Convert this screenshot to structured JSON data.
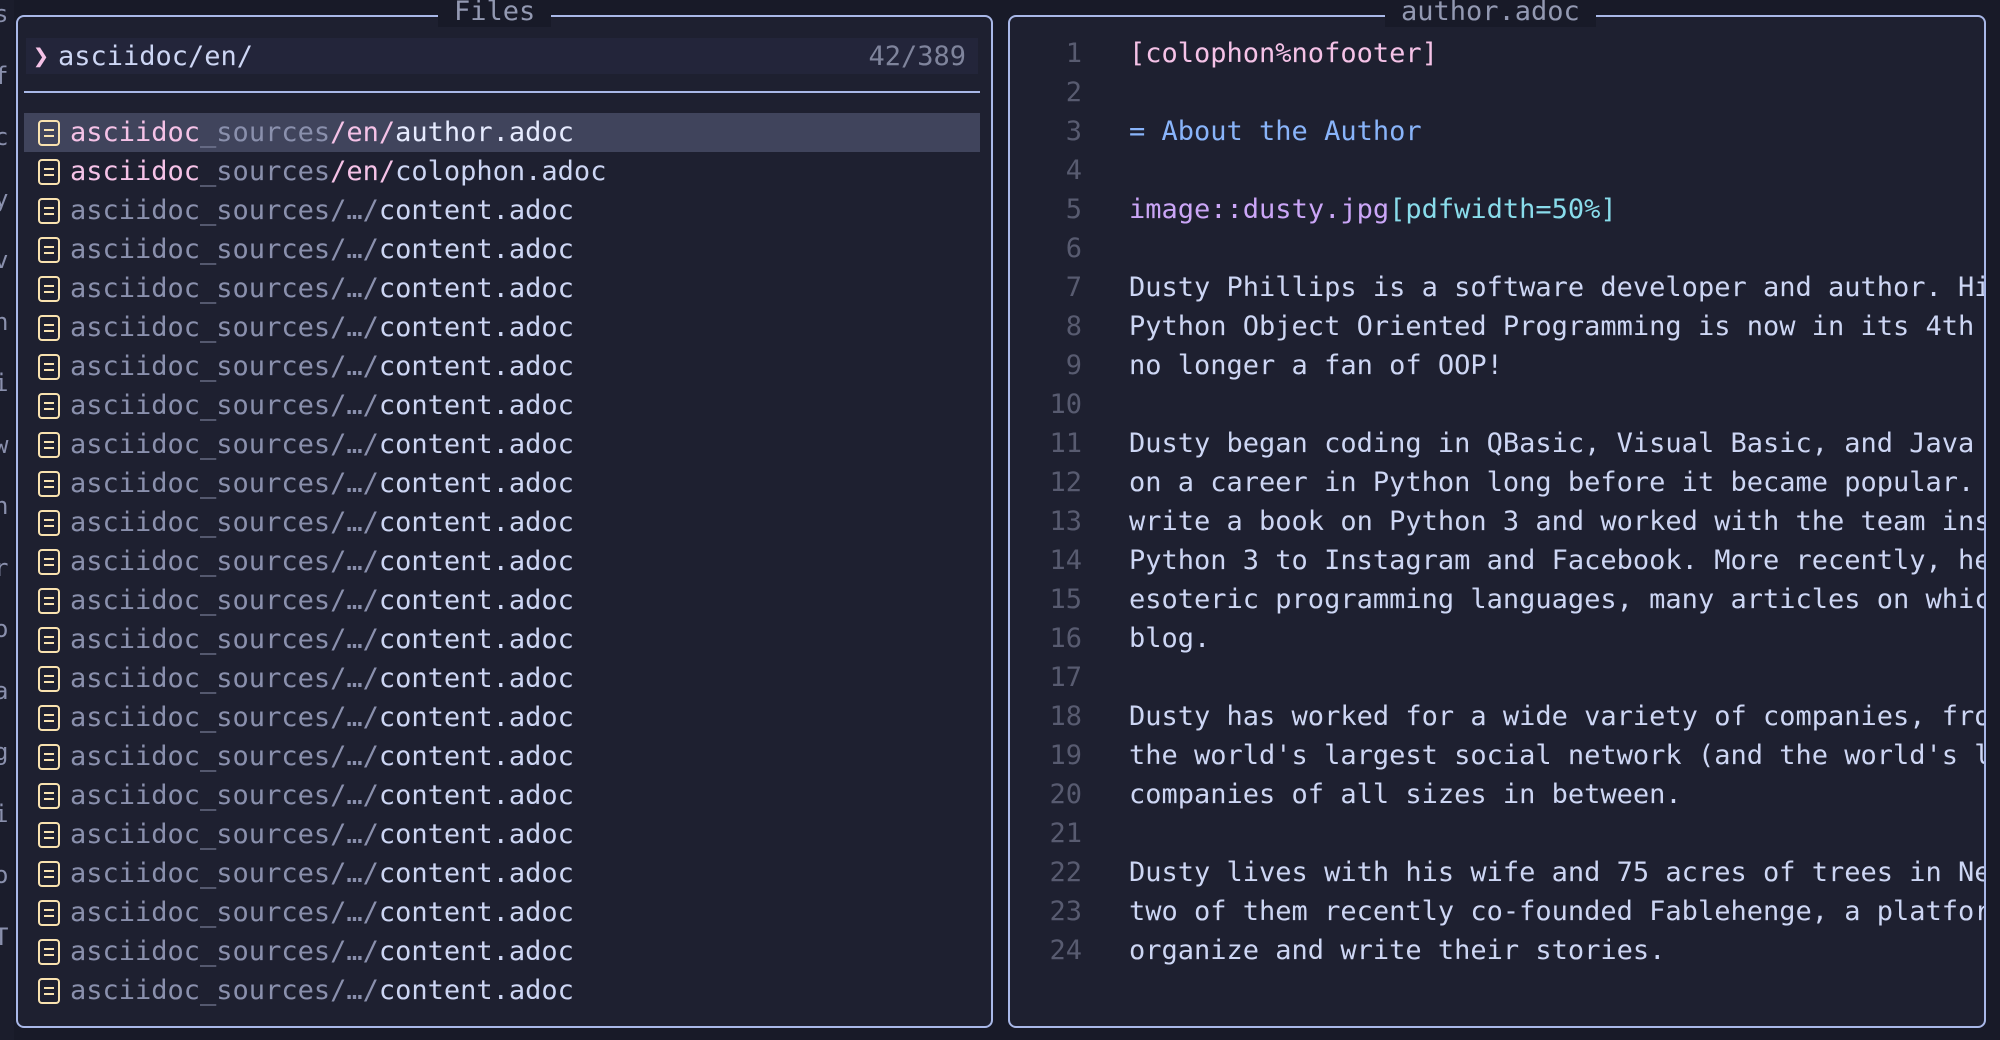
{
  "left_edge_fragments": [
    "s",
    "f",
    "c",
    "y",
    "v",
    "n",
    "i",
    "w",
    "n",
    "r",
    "o",
    "a",
    "g",
    "i",
    "o",
    "T"
  ],
  "files_pane": {
    "title": "Files",
    "prompt_symbol": "❯",
    "query": "asciidoc/en/",
    "count": "42/389",
    "items": [
      {
        "segments": [
          {
            "t": "asciidoc",
            "c": "seg-match"
          },
          {
            "t": "_sources",
            "c": "seg-dim"
          },
          {
            "t": "/en/",
            "c": "seg-match"
          },
          {
            "t": "author.adoc",
            "c": "seg-name"
          }
        ],
        "selected": true
      },
      {
        "segments": [
          {
            "t": "asciidoc",
            "c": "seg-match"
          },
          {
            "t": "_sources",
            "c": "seg-dim"
          },
          {
            "t": "/en/",
            "c": "seg-match"
          },
          {
            "t": "colophon.adoc",
            "c": "seg-name"
          }
        ]
      },
      {
        "segments": [
          {
            "t": "asciidoc_sources/…/",
            "c": "seg-dim"
          },
          {
            "t": "content.adoc",
            "c": "seg-name"
          }
        ]
      },
      {
        "segments": [
          {
            "t": "asciidoc_sources/…/",
            "c": "seg-dim"
          },
          {
            "t": "content.adoc",
            "c": "seg-name"
          }
        ]
      },
      {
        "segments": [
          {
            "t": "asciidoc_sources/…/",
            "c": "seg-dim"
          },
          {
            "t": "content.adoc",
            "c": "seg-name"
          }
        ]
      },
      {
        "segments": [
          {
            "t": "asciidoc_sources/…/",
            "c": "seg-dim"
          },
          {
            "t": "content.adoc",
            "c": "seg-name"
          }
        ]
      },
      {
        "segments": [
          {
            "t": "asciidoc_sources/…/",
            "c": "seg-dim"
          },
          {
            "t": "content.adoc",
            "c": "seg-name"
          }
        ]
      },
      {
        "segments": [
          {
            "t": "asciidoc_sources/…/",
            "c": "seg-dim"
          },
          {
            "t": "content.adoc",
            "c": "seg-name"
          }
        ]
      },
      {
        "segments": [
          {
            "t": "asciidoc_sources/…/",
            "c": "seg-dim"
          },
          {
            "t": "content.adoc",
            "c": "seg-name"
          }
        ]
      },
      {
        "segments": [
          {
            "t": "asciidoc_sources/…/",
            "c": "seg-dim"
          },
          {
            "t": "content.adoc",
            "c": "seg-name"
          }
        ]
      },
      {
        "segments": [
          {
            "t": "asciidoc_sources/…/",
            "c": "seg-dim"
          },
          {
            "t": "content.adoc",
            "c": "seg-name"
          }
        ]
      },
      {
        "segments": [
          {
            "t": "asciidoc_sources/…/",
            "c": "seg-dim"
          },
          {
            "t": "content.adoc",
            "c": "seg-name"
          }
        ]
      },
      {
        "segments": [
          {
            "t": "asciidoc_sources/…/",
            "c": "seg-dim"
          },
          {
            "t": "content.adoc",
            "c": "seg-name"
          }
        ]
      },
      {
        "segments": [
          {
            "t": "asciidoc_sources/…/",
            "c": "seg-dim"
          },
          {
            "t": "content.adoc",
            "c": "seg-name"
          }
        ]
      },
      {
        "segments": [
          {
            "t": "asciidoc_sources/…/",
            "c": "seg-dim"
          },
          {
            "t": "content.adoc",
            "c": "seg-name"
          }
        ]
      },
      {
        "segments": [
          {
            "t": "asciidoc_sources/…/",
            "c": "seg-dim"
          },
          {
            "t": "content.adoc",
            "c": "seg-name"
          }
        ]
      },
      {
        "segments": [
          {
            "t": "asciidoc_sources/…/",
            "c": "seg-dim"
          },
          {
            "t": "content.adoc",
            "c": "seg-name"
          }
        ]
      },
      {
        "segments": [
          {
            "t": "asciidoc_sources/…/",
            "c": "seg-dim"
          },
          {
            "t": "content.adoc",
            "c": "seg-name"
          }
        ]
      },
      {
        "segments": [
          {
            "t": "asciidoc_sources/…/",
            "c": "seg-dim"
          },
          {
            "t": "content.adoc",
            "c": "seg-name"
          }
        ]
      },
      {
        "segments": [
          {
            "t": "asciidoc_sources/…/",
            "c": "seg-dim"
          },
          {
            "t": "content.adoc",
            "c": "seg-name"
          }
        ]
      },
      {
        "segments": [
          {
            "t": "asciidoc_sources/…/",
            "c": "seg-dim"
          },
          {
            "t": "content.adoc",
            "c": "seg-name"
          }
        ]
      },
      {
        "segments": [
          {
            "t": "asciidoc_sources/…/",
            "c": "seg-dim"
          },
          {
            "t": "content.adoc",
            "c": "seg-name"
          }
        ]
      },
      {
        "segments": [
          {
            "t": "asciidoc_sources/…/",
            "c": "seg-dim"
          },
          {
            "t": "content.adoc",
            "c": "seg-name"
          }
        ]
      }
    ]
  },
  "preview_pane": {
    "title": "author.adoc",
    "lines": [
      {
        "n": "1",
        "segments": [
          {
            "t": "[colophon%nofooter]",
            "c": "c-pink"
          }
        ]
      },
      {
        "n": "2",
        "segments": []
      },
      {
        "n": "3",
        "segments": [
          {
            "t": "= About the Author",
            "c": "c-blue"
          }
        ]
      },
      {
        "n": "4",
        "segments": []
      },
      {
        "n": "5",
        "segments": [
          {
            "t": "image::",
            "c": "c-mauve"
          },
          {
            "t": "dusty.jpg",
            "c": "c-mauve"
          },
          {
            "t": "[pdfwidth=50%]",
            "c": "c-sky"
          }
        ]
      },
      {
        "n": "6",
        "segments": []
      },
      {
        "n": "7",
        "segments": [
          {
            "t": "Dusty Phillips is a software developer and author. Hi",
            "c": "c-plain"
          }
        ]
      },
      {
        "n": "8",
        "segments": [
          {
            "t": "Python Object Oriented Programming is now in its 4th",
            "c": "c-plain"
          }
        ]
      },
      {
        "n": "9",
        "segments": [
          {
            "t": "no longer a fan of OOP!",
            "c": "c-plain"
          }
        ]
      },
      {
        "n": "10",
        "segments": []
      },
      {
        "n": "11",
        "segments": [
          {
            "t": "Dusty began coding in QBasic, Visual Basic, and Java",
            "c": "c-plain"
          }
        ]
      },
      {
        "n": "12",
        "segments": [
          {
            "t": "on a career in Python long before it became popular.",
            "c": "c-plain"
          }
        ]
      },
      {
        "n": "13",
        "segments": [
          {
            "t": "write a book on Python 3 and worked with the team ins",
            "c": "c-plain"
          }
        ]
      },
      {
        "n": "14",
        "segments": [
          {
            "t": "Python 3 to Instagram and Facebook. More recently, he",
            "c": "c-plain"
          }
        ]
      },
      {
        "n": "15",
        "segments": [
          {
            "t": "esoteric programming languages, many articles on whic",
            "c": "c-plain"
          }
        ]
      },
      {
        "n": "16",
        "segments": [
          {
            "t": "blog.",
            "c": "c-plain"
          }
        ]
      },
      {
        "n": "17",
        "segments": []
      },
      {
        "n": "18",
        "segments": [
          {
            "t": "Dusty has worked for a wide variety of companies, fro",
            "c": "c-plain"
          }
        ]
      },
      {
        "n": "19",
        "segments": [
          {
            "t": "the world's largest social network (and the world's l",
            "c": "c-plain"
          }
        ]
      },
      {
        "n": "20",
        "segments": [
          {
            "t": "companies of all sizes in between.",
            "c": "c-plain"
          }
        ]
      },
      {
        "n": "21",
        "segments": []
      },
      {
        "n": "22",
        "segments": [
          {
            "t": "Dusty lives with his wife and 75 acres of trees in Ne",
            "c": "c-plain"
          }
        ]
      },
      {
        "n": "23",
        "segments": [
          {
            "t": "two of them recently co-founded Fablehenge, a platfor",
            "c": "c-plain"
          }
        ]
      },
      {
        "n": "24",
        "segments": [
          {
            "t": "organize and write their stories.",
            "c": "c-plain"
          }
        ]
      }
    ]
  }
}
